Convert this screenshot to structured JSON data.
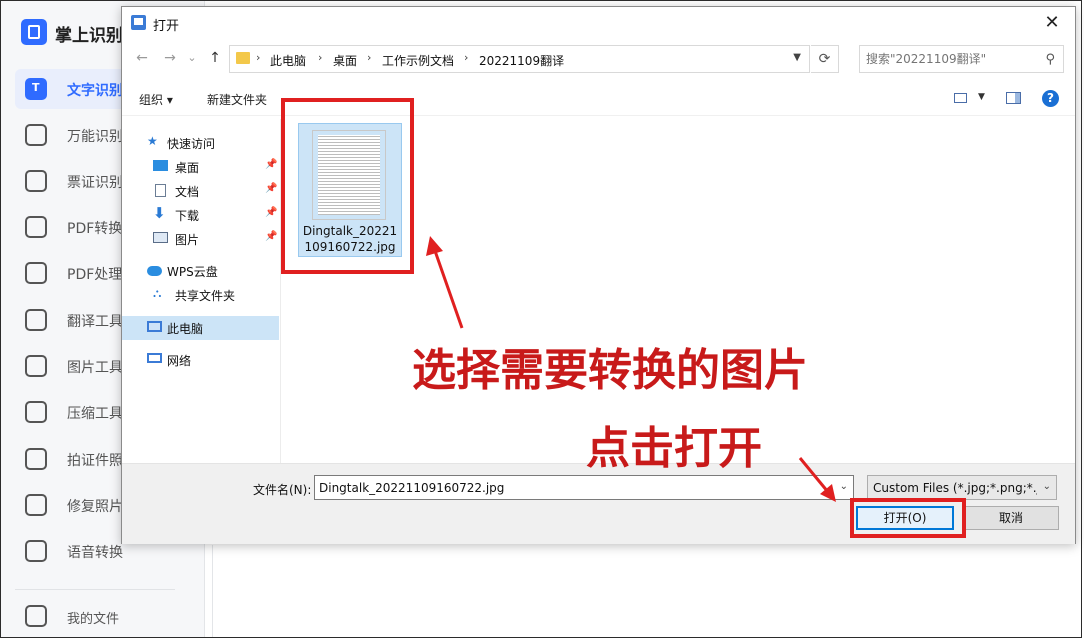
{
  "app": {
    "title": "掌上识别",
    "nav_items": [
      {
        "label": "文字识别",
        "icon": "text-recognition-icon",
        "active": true
      },
      {
        "label": "万能识别",
        "icon": "universal-scan-icon"
      },
      {
        "label": "票证识别",
        "icon": "ticket-icon"
      },
      {
        "label": "PDF转换",
        "icon": "pdf-convert-icon"
      },
      {
        "label": "PDF处理",
        "icon": "pdf-process-icon"
      },
      {
        "label": "翻译工具",
        "icon": "translate-icon"
      },
      {
        "label": "图片工具",
        "icon": "image-tool-icon"
      },
      {
        "label": "压缩工具",
        "icon": "compress-icon"
      },
      {
        "label": "拍证件照",
        "icon": "id-photo-icon"
      },
      {
        "label": "修复照片",
        "icon": "repair-photo-icon"
      },
      {
        "label": "语音转换",
        "icon": "voice-convert-icon"
      }
    ],
    "my_files": "我的文件"
  },
  "dialog": {
    "title": "打开",
    "close": "✕",
    "nav": {
      "back": "←",
      "forward": "→",
      "dropdown": "⌄",
      "up": "↑"
    },
    "breadcrumb": [
      "此电脑",
      "桌面",
      "工作示例文档",
      "20221109翻译"
    ],
    "search_placeholder": "搜索\"20221109翻译\"",
    "toolbar": {
      "organize": "组织 ▾",
      "new_folder": "新建文件夹",
      "help": "?"
    },
    "tree": {
      "quick_access": "快速访问",
      "desktop": "桌面",
      "documents": "文档",
      "downloads": "下载",
      "pictures": "图片",
      "wps_cloud": "WPS云盘",
      "shared_folder": "共享文件夹",
      "this_pc": "此电脑",
      "network": "网络"
    },
    "files": [
      {
        "name": "Dingtalk_20221109160722.jpg"
      }
    ],
    "filename_label": "文件名(N):",
    "filename_value": "Dingtalk_20221109160722.jpg",
    "filter": "Custom Files (*.jpg;*.png;*.jpeg)",
    "open_button": "打开(O)",
    "cancel_button": "取消"
  },
  "annotations": {
    "select_hint": "选择需要转换的图片",
    "click_hint": "点击打开",
    "color": "#e02020"
  }
}
